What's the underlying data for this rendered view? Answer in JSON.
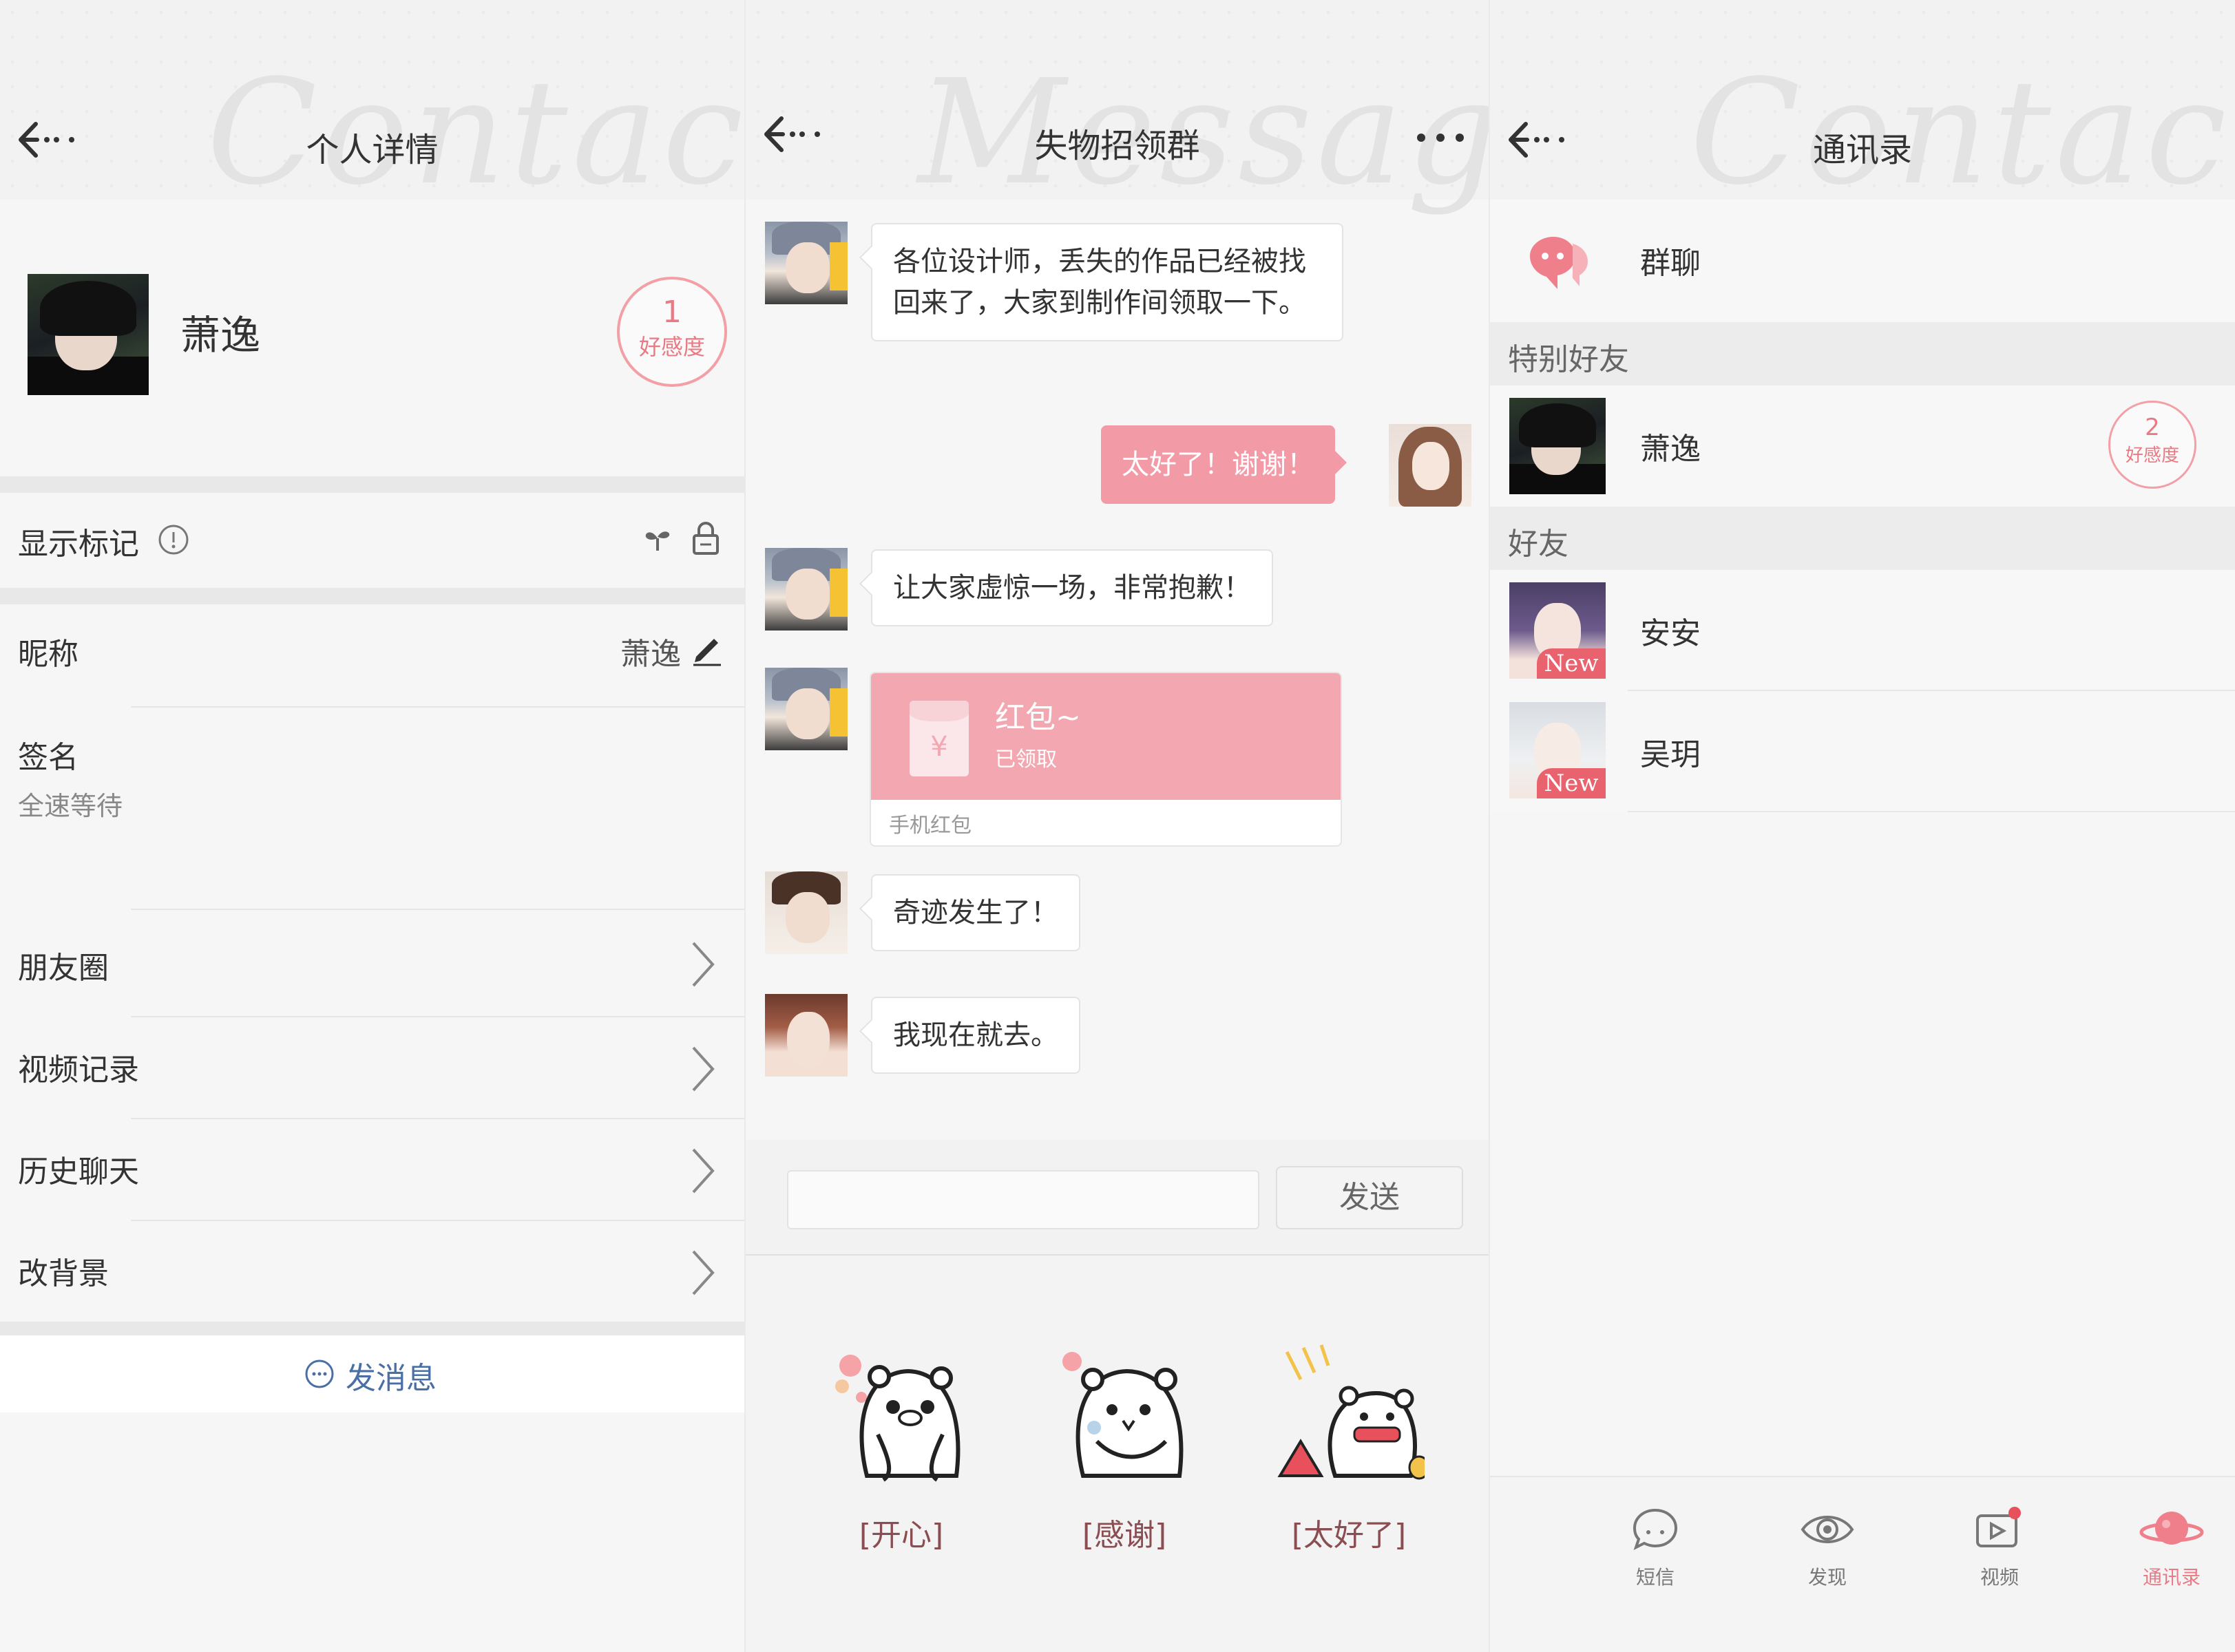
{
  "profile_panel": {
    "title": "个人详情",
    "watermark": "Contacts",
    "name": "萧逸",
    "affinity_value": "1",
    "affinity_label": "好感度",
    "show_mark_label": "显示标记",
    "nickname_label": "昵称",
    "nickname_value": "萧逸",
    "signature_label": "签名",
    "signature_value": "全速等待",
    "menu": [
      {
        "label": "朋友圈"
      },
      {
        "label": "视频记录"
      },
      {
        "label": "历史聊天"
      },
      {
        "label": "改背景"
      }
    ],
    "send_message_label": "发消息"
  },
  "chat_panel": {
    "title": "失物招领群",
    "watermark": "Message",
    "messages": [
      {
        "text": "各位设计师，丢失的作品已经被找回来了，大家到制作间领取一下。"
      },
      {
        "text": "太好了！谢谢！"
      },
      {
        "text": "让大家虚惊一场，非常抱歉！"
      },
      {
        "redpack_title": "红包~",
        "redpack_status": "已领取",
        "redpack_source": "手机红包",
        "redpack_symbol": "¥"
      },
      {
        "text": "奇迹发生了！"
      },
      {
        "text": "我现在就去。"
      }
    ],
    "send_label": "发送",
    "stickers": [
      {
        "label": "[开心]"
      },
      {
        "label": "[感谢]"
      },
      {
        "label": "[太好了]"
      }
    ]
  },
  "contacts_panel": {
    "title": "通讯录",
    "watermark": "Contacts",
    "group_chat_label": "群聊",
    "special_section": "特别好友",
    "special_contact": {
      "name": "萧逸",
      "affinity_value": "2",
      "affinity_label": "好感度"
    },
    "friends_section": "好友",
    "friends": [
      {
        "name": "安安",
        "tag": "New"
      },
      {
        "name": "吴玥",
        "tag": "New"
      }
    ],
    "tabs": [
      {
        "label": "短信",
        "icon": "message-bubble-icon"
      },
      {
        "label": "发现",
        "icon": "eye-icon"
      },
      {
        "label": "视频",
        "icon": "video-icon"
      },
      {
        "label": "通讯录",
        "icon": "planet-icon"
      }
    ]
  },
  "colors": {
    "accent": "#f29aa6",
    "accent_text": "#e97a86",
    "sticker_label": "#8a4e52",
    "background": "#f6f6f6"
  }
}
